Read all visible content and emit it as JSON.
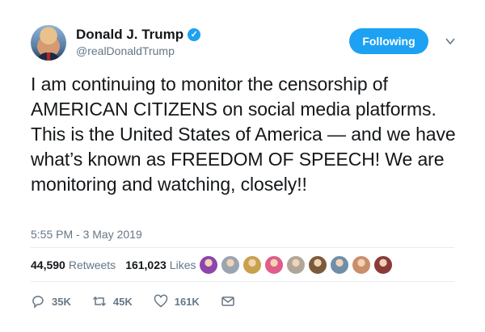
{
  "user": {
    "name": "Donald J. Trump",
    "handle": "@realDonaldTrump",
    "verified_icon": "verified-badge-icon"
  },
  "header": {
    "follow_label": "Following"
  },
  "tweet": {
    "text": "I am continuing to monitor the censorship of AMERICAN CITIZENS on social media platforms. This is the United States of America — and we have what’s known as FREEDOM OF SPEECH! We are monitoring and watching, closely!!",
    "timestamp": "5:55 PM - 3 May 2019"
  },
  "stats": {
    "retweets_count": "44,590",
    "retweets_label": "Retweets",
    "likes_count": "161,023",
    "likes_label": "Likes"
  },
  "likers": [
    {
      "color": "#8e44ad"
    },
    {
      "color": "#9aa5b1"
    },
    {
      "color": "#c9a14a"
    },
    {
      "color": "#e05c8a"
    },
    {
      "color": "#b0a69a"
    },
    {
      "color": "#7c5a3c"
    },
    {
      "color": "#6f8fa8"
    },
    {
      "color": "#c98f6b"
    },
    {
      "color": "#8b3a3a"
    }
  ],
  "actions": {
    "reply_count": "35K",
    "retweet_count": "45K",
    "like_count": "161K"
  },
  "colors": {
    "accent": "#1da1f2",
    "text": "#14171a",
    "muted": "#657786"
  }
}
